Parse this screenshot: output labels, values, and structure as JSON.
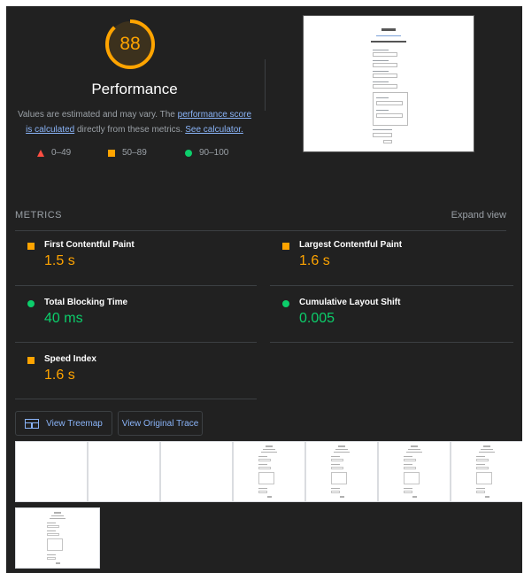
{
  "gauge": {
    "score": "88",
    "score_fraction": 0.88,
    "color": "#ffa400",
    "title": "Performance",
    "desc_prefix": "Values are estimated and may vary. The ",
    "desc_link1": "performance score is calculated",
    "desc_middle": " directly from these metrics. ",
    "desc_link2": "See calculator."
  },
  "legend": [
    {
      "range": "0–49",
      "icon": "triangle-icon",
      "color": "#ff4e42"
    },
    {
      "range": "50–89",
      "icon": "square-icon",
      "color": "#ffa400"
    },
    {
      "range": "90–100",
      "icon": "circle-icon",
      "color": "#0cce6b"
    }
  ],
  "metrics": {
    "header": "METRICS",
    "expand": "Expand view",
    "items": [
      {
        "name": "First Contentful Paint",
        "value": "1.5 s",
        "status": "average"
      },
      {
        "name": "Largest Contentful Paint",
        "value": "1.6 s",
        "status": "average"
      },
      {
        "name": "Total Blocking Time",
        "value": "40 ms",
        "status": "pass"
      },
      {
        "name": "Cumulative Layout Shift",
        "value": "0.005",
        "status": "pass"
      },
      {
        "name": "Speed Index",
        "value": "1.6 s",
        "status": "average"
      }
    ]
  },
  "buttons": {
    "treemap": "View Treemap",
    "trace": "View Original Trace"
  },
  "colors": {
    "background": "#212121",
    "average": "#ffa400",
    "pass": "#0cce6b",
    "fail": "#ff4e42",
    "link": "#8ab4f8"
  }
}
